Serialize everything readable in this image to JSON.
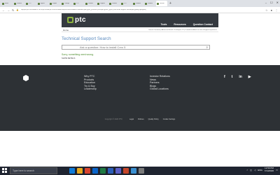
{
  "browser": {
    "tabs": [
      {
        "label": "Inbox"
      },
      {
        "label": "Windchi"
      },
      {
        "label": "PTC"
      },
      {
        "label": "applica"
      },
      {
        "label": "Engine"
      },
      {
        "label": "Change"
      },
      {
        "label": "PTC"
      },
      {
        "label": "Windchi"
      },
      {
        "label": "Support"
      },
      {
        "label": "Windchi"
      },
      {
        "label": "PTC"
      },
      {
        "label": "Windchi"
      },
      {
        "label": "Windchi"
      },
      {
        "label": "Technic"
      }
    ],
    "new_tab": "+",
    "url": "support.ptc.com/search/?k=https://www.ptc.com/en/search#q=error&t=All&sort=relevancy&f:@ptc_product=[Creo]&f:@doc_type=[Technical Support Articles]&f:@lang=[English]",
    "window_controls": [
      "–",
      "☐",
      "✕"
    ]
  },
  "header": {
    "logo_text": "ptc",
    "nav": [
      "Tools",
      "Resources",
      "Question Contact"
    ],
    "home": "Home",
    "subnav_links": "Search Overview  |  Advanced Search Techniques PT  |  Provide feedback on new eSupport experience"
  },
  "main": {
    "title": "Technical Support Search",
    "search_placeholder": "Ask a question: How to install Creo 5",
    "error_text": "Sorry, something went wrong.",
    "details_link": "SHOW DETAILS"
  },
  "footer": {
    "col1": [
      "Why PTC",
      "Products",
      "Education",
      "Try & Buy",
      "Leadership"
    ],
    "col2": [
      "Investor Relations",
      "News",
      "Partners",
      "Blogs",
      "Global Locations"
    ],
    "social": [
      "f",
      "t",
      "in",
      "▶"
    ],
    "copyright": "Copyright © 2020 PTC",
    "bottom_links": [
      "Legal",
      "Policies",
      "Quality Policy",
      "Cookie Settings"
    ]
  },
  "taskbar": {
    "search_text": "Type here to search",
    "apps": [
      {
        "icon": "task-view-icon",
        "color": "#1f2430"
      },
      {
        "icon": "edge-icon",
        "color": "#0f7bd8"
      },
      {
        "icon": "explorer-icon",
        "color": "#e8a81c"
      },
      {
        "icon": "chrome-icon",
        "color": "#d9442f"
      },
      {
        "icon": "outlook-icon",
        "color": "#0a64c9"
      },
      {
        "icon": "excel-icon",
        "color": "#1f7a43"
      },
      {
        "icon": "word-icon",
        "color": "#2b5eb8"
      },
      {
        "icon": "teams-icon",
        "color": "#5b5fc7"
      },
      {
        "icon": "powerpoint-icon",
        "color": "#c5462a"
      },
      {
        "icon": "app-icon",
        "color": "#3a8fd1"
      },
      {
        "icon": "app-icon",
        "color": "#7a7a7a"
      }
    ],
    "lang": "ENG",
    "time": "12:59 PM",
    "date": "7/14/2020"
  }
}
